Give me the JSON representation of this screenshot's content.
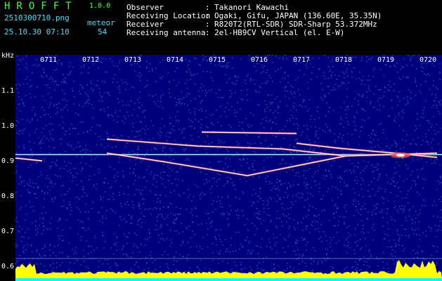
{
  "header": {
    "app_title": "HROFFT",
    "app_version": "1.0.0",
    "file_name": "2510300710.png",
    "timestamp": "25.10.30 07:10",
    "meteor_label": "meteor",
    "meteor_count": "54"
  },
  "info": [
    {
      "key": "Observer",
      "value": "Takanori Kawachi"
    },
    {
      "key": "Receiving Location",
      "value": "Ogaki, Gifu, JAPAN (136.60E, 35.35N)"
    },
    {
      "key": "Receiver",
      "value": "R820T2(RTL-SDR) SDR-Sharp 53.372MHz"
    },
    {
      "key": "Receiving antenna",
      "value": "2el-HB9CV Vertical (el. E-W)"
    }
  ],
  "separator": ":",
  "spectrogram": {
    "y_unit": "kHz",
    "y_ticks": [
      "1.1",
      "1.0",
      "0.9",
      "0.8",
      "0.7",
      "0.6"
    ],
    "time_ticks": [
      "0711",
      "0712",
      "0713",
      "0714",
      "0715",
      "0716",
      "0717",
      "0718",
      "0719",
      "0720"
    ],
    "colors": {
      "background": "#00007a",
      "noise": "#3a8cff",
      "trace_core": "#ffffff",
      "trace_edge": "#ff5050",
      "carrier": "#9ff0ff",
      "level_bar": "#ffff00",
      "level_base": "#00ffff"
    }
  }
}
